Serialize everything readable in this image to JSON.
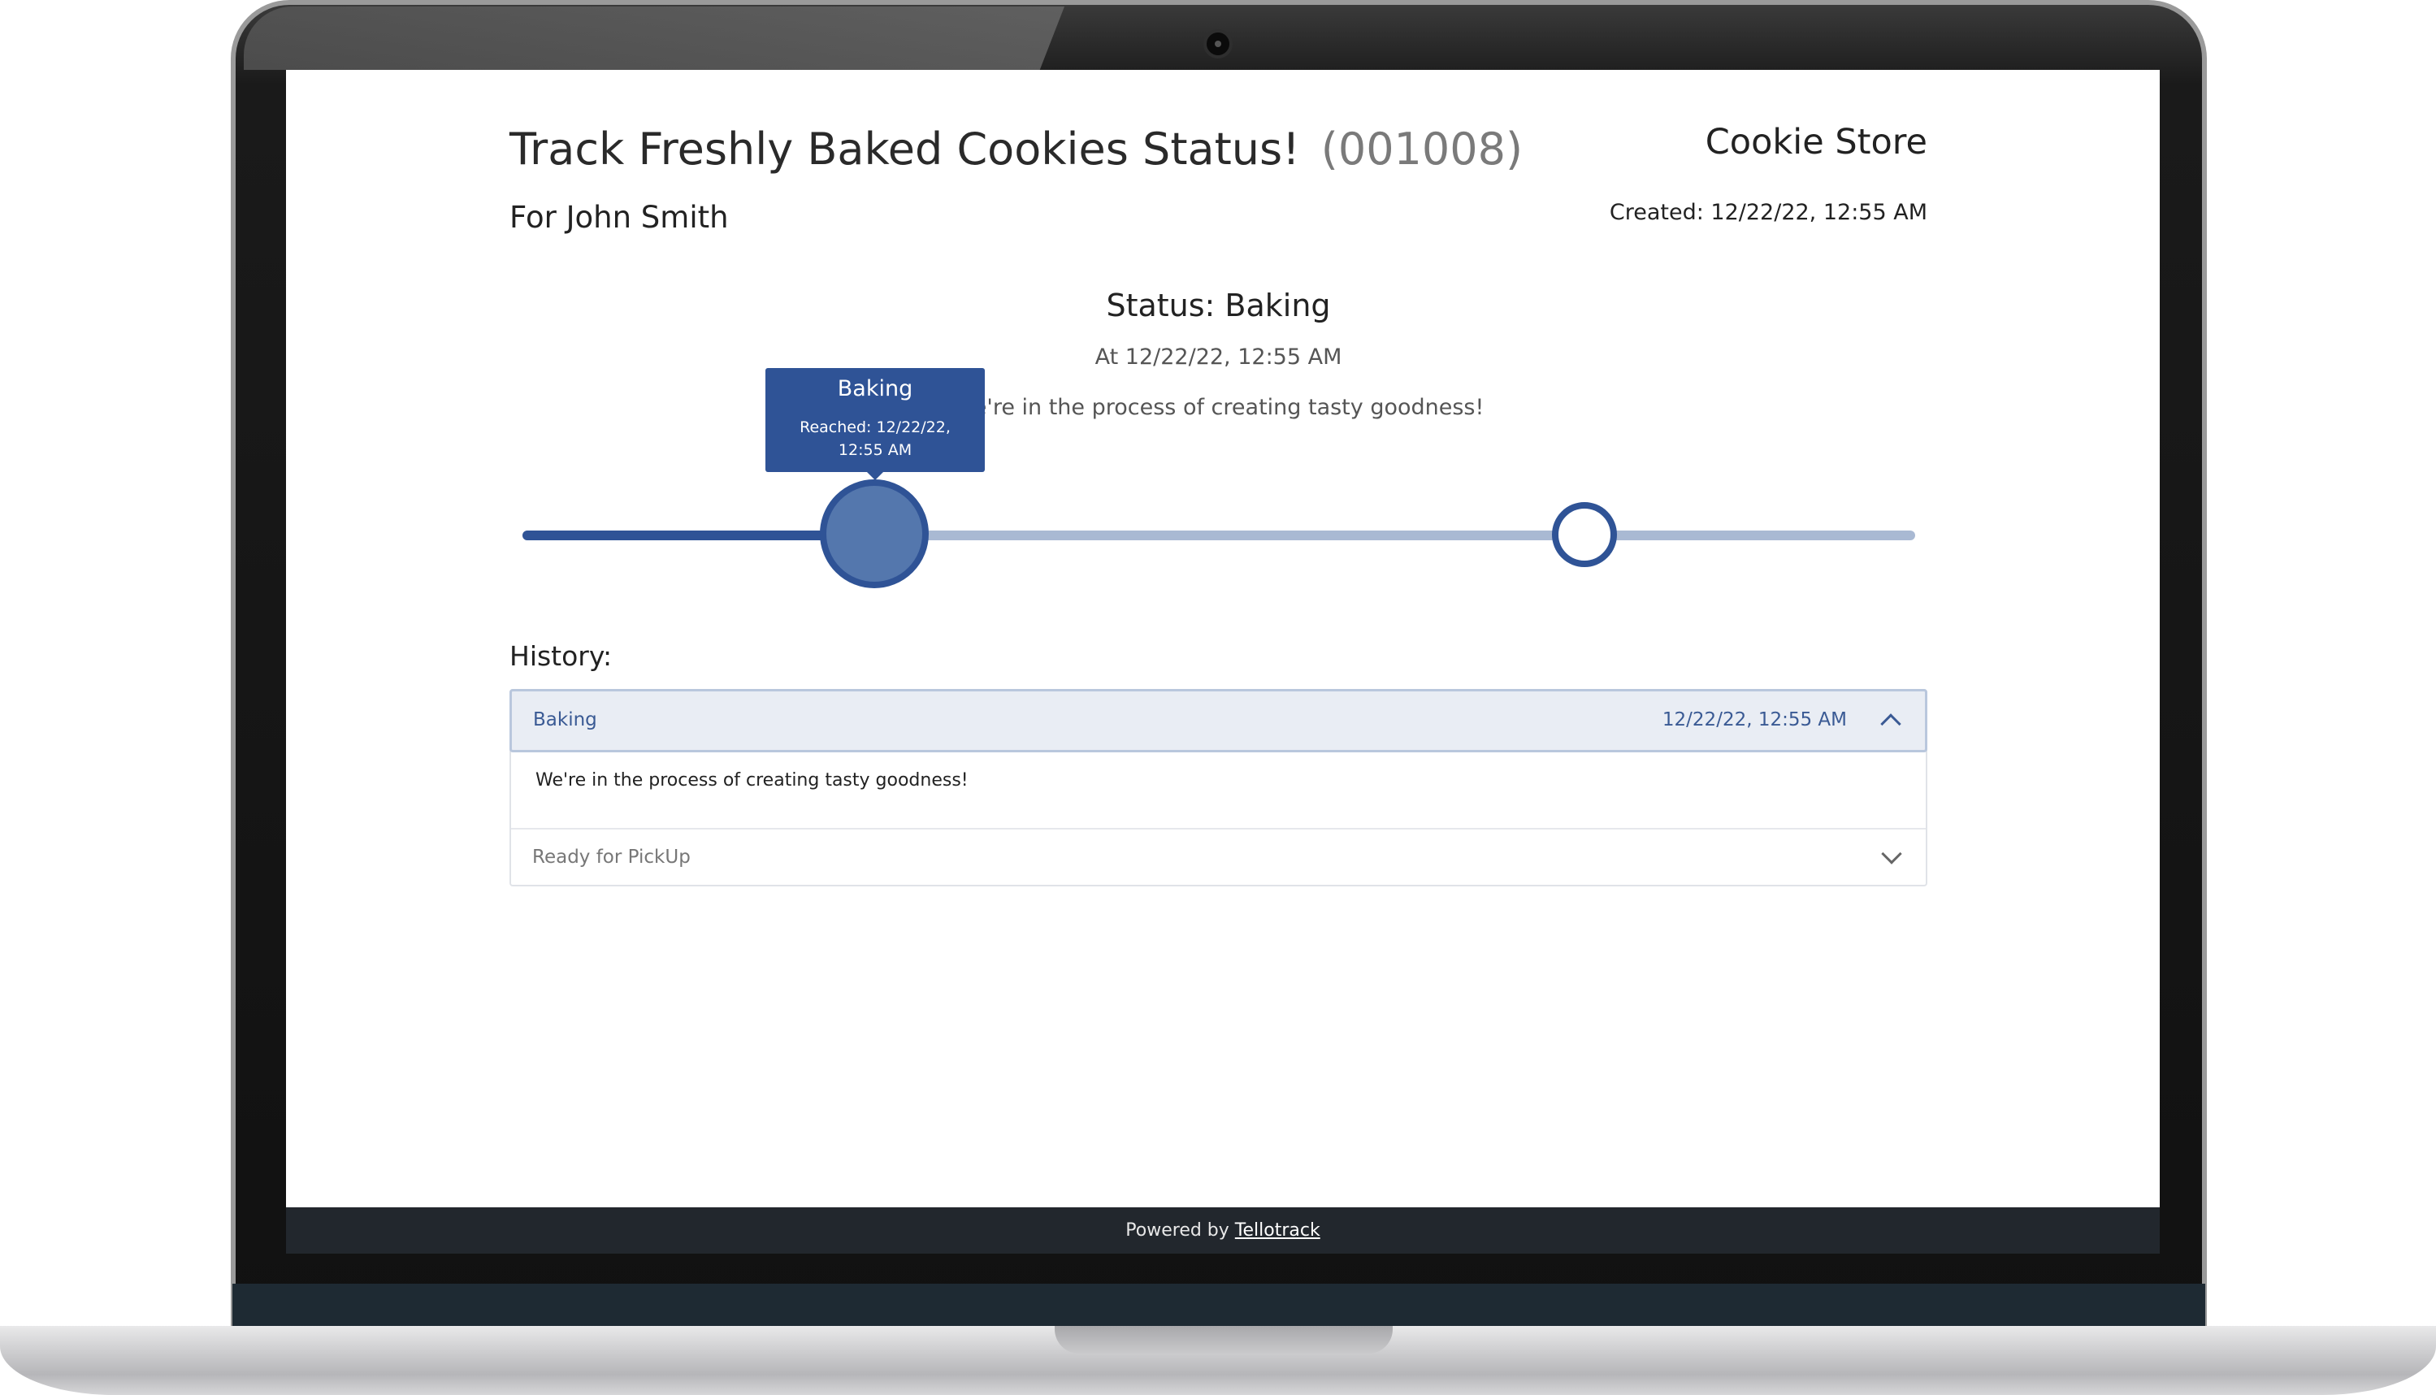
{
  "page": {
    "title": "Track Freshly Baked Cookies Status!",
    "order_id": "(001008)",
    "for_name": "For John Smith",
    "store_name": "Cookie Store",
    "created": "Created: 12/22/22, 12:55 AM"
  },
  "status": {
    "title": "Status: Baking",
    "at": "At 12/22/22, 12:55 AM",
    "description": "We're in the process of creating tasty goodness!"
  },
  "progress": {
    "steps_total": 2,
    "current_step": 1,
    "filled_fraction": 0.255,
    "tooltip_title": "Baking",
    "tooltip_reached": "Reached: 12/22/22, 12:55 AM"
  },
  "history": {
    "label": "History:",
    "items": [
      {
        "title": "Baking",
        "date": "12/22/22, 12:55 AM",
        "body": "We're in the process of creating tasty goodness!",
        "expanded": true
      },
      {
        "title": "Ready for PickUp",
        "expanded": false
      }
    ]
  },
  "footer": {
    "prefix": "Powered by ",
    "link": "Tellotrack"
  },
  "colors": {
    "accent": "#2f5396",
    "track_inactive": "#a9b9d3",
    "footer_bg": "#22272d"
  }
}
